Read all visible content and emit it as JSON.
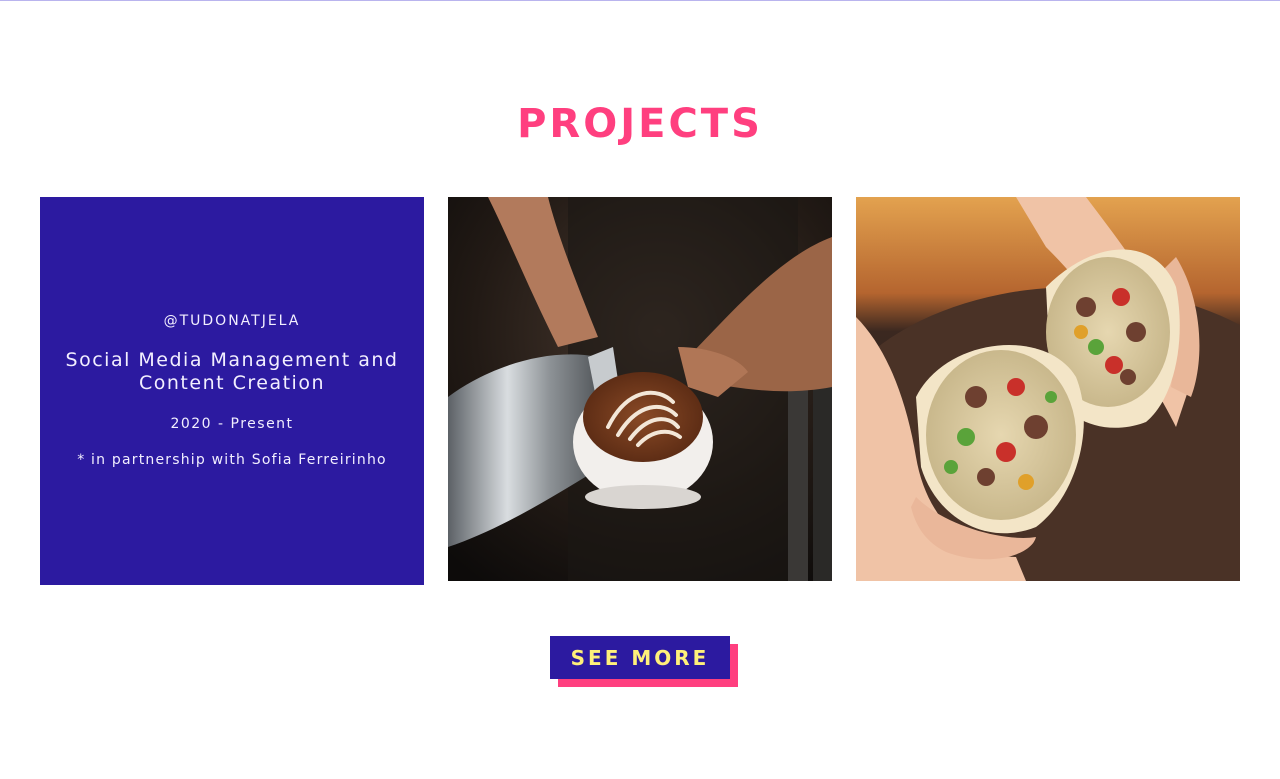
{
  "colors": {
    "accent_pink": "#ff3f7f",
    "brand_blue": "#2c1aa0",
    "highlight_yellow": "#fff07a",
    "text_light": "#f2efff"
  },
  "section": {
    "title": "PROJECTS"
  },
  "cards": {
    "text_card": {
      "handle": "@TUDONATJELA",
      "headline": "Social Media Management and Content Creation",
      "dates": "2020 - Present",
      "note": "* in partnership with Sofia Ferreirinho"
    },
    "coffee_card": {
      "image": "latte-art-pour-photo"
    },
    "burrito_card": {
      "image": "burrito-halves-photo"
    }
  },
  "cta": {
    "label": "SEE MORE"
  }
}
